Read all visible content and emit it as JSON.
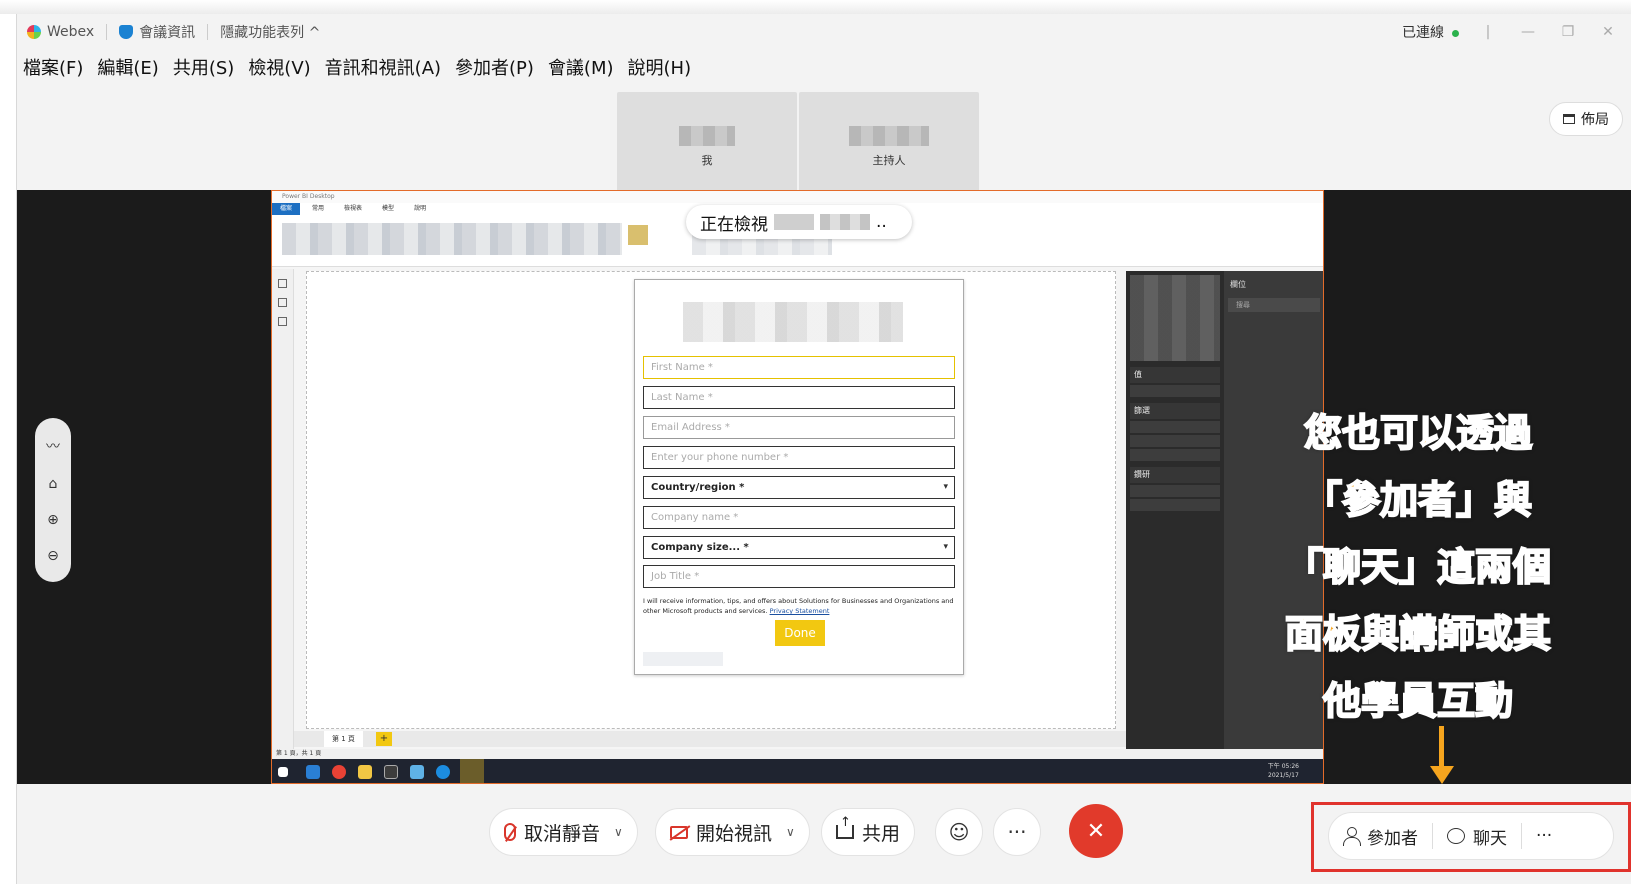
{
  "titlebar": {
    "app_name": "Webex",
    "meeting_info": "會議資訊",
    "hide_menu": "隱藏功能表列 ^",
    "connection": "已連線"
  },
  "menu": [
    "檔案(F)",
    "編輯(E)",
    "共用(S)",
    "檢視(V)",
    "音訊和視訊(A)",
    "參加者(P)",
    "會議(M)",
    "說明(H)"
  ],
  "tiles": [
    {
      "name": "我"
    },
    {
      "name": "主持人"
    }
  ],
  "layout_label": "佈局",
  "share": {
    "viewing_label": "正在檢視",
    "viewing_suffix": "..",
    "app_title": "Power BI Desktop",
    "ribbon_tabs": [
      "檔案",
      "常用",
      "檢視表",
      "模型",
      "說明"
    ],
    "page_tab": "第 1 頁",
    "status": "第 1 頁，共 1 頁",
    "fields_pane_title": "欄位",
    "fields_search": "搜尋",
    "pane_sections": [
      "值",
      "篩選",
      "鑽研"
    ],
    "clock_time": "下午 05:26",
    "clock_date": "2021/5/17"
  },
  "form": {
    "fields": [
      {
        "label": "First Name *",
        "type": "text",
        "state": "active"
      },
      {
        "label": "Last Name *",
        "type": "text",
        "state": ""
      },
      {
        "label": "Email Address *",
        "type": "text",
        "state": "light"
      },
      {
        "label": "Enter your phone number *",
        "type": "text",
        "state": ""
      },
      {
        "label": "Country/region *",
        "type": "select",
        "state": ""
      },
      {
        "label": "Company name *",
        "type": "text",
        "state": ""
      },
      {
        "label": "Company size... *",
        "type": "select",
        "state": ""
      },
      {
        "label": "Job Title *",
        "type": "text",
        "state": ""
      }
    ],
    "consent_text": "I will receive information, tips, and offers about Solutions for Businesses and Organizations and other Microsoft products and services.",
    "privacy_link": "Privacy Statement",
    "done_label": "Done"
  },
  "annotation": {
    "lines": [
      "您也可以透過",
      "「參加者」與",
      "「聊天」這兩個",
      "面板與講師或其",
      "他學員互動"
    ],
    "color": "#f6a51e"
  },
  "controls": {
    "unmute": "取消靜音",
    "start_video": "開始視訊",
    "share": "共用",
    "participants": "參加者",
    "chat": "聊天",
    "more": "···",
    "leave_icon": "close-icon",
    "leave_color": "#e13a2b"
  }
}
